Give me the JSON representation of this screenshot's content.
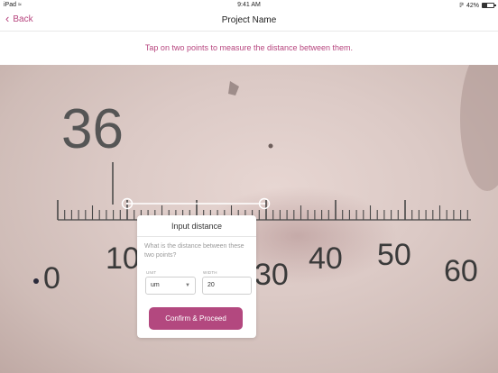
{
  "status_bar": {
    "device": "iPad",
    "wifi_icon": "wifi-icon",
    "time": "9:41 AM",
    "bluetooth_icon": "bluetooth-icon",
    "battery_percent": "42%",
    "battery_level": 0.42
  },
  "nav": {
    "back_label": "Back",
    "title": "Project Name"
  },
  "instruction": "Tap on two points to measure the distance between them.",
  "image": {
    "scale_label_top": "36",
    "scale_numbers": [
      "0",
      "10",
      "30",
      "40",
      "50",
      "60"
    ]
  },
  "dialog": {
    "title": "Input distance",
    "question": "What is the distance between these two points?",
    "unit_label": "UNIT",
    "unit_value": "um",
    "width_label": "WIDTH",
    "width_value": "20",
    "confirm_label": "Confirm & Proceed"
  },
  "colors": {
    "accent": "#b7467f",
    "button": "#b3487f"
  }
}
